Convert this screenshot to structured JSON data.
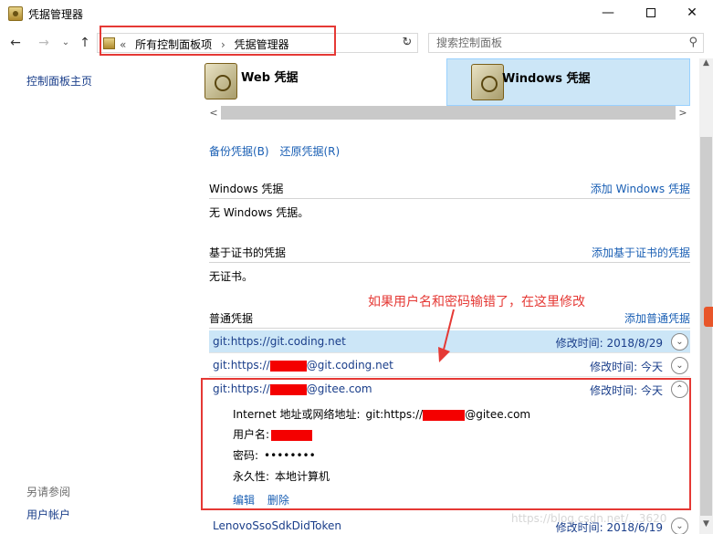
{
  "window": {
    "title": "凭据管理器",
    "min_glyph": "—",
    "close_glyph": "✕"
  },
  "nav": {
    "back_glyph": "←",
    "forward_glyph": "→",
    "history_glyph": "⌄",
    "up_glyph": "↑",
    "breadcrumb_prefix": "«",
    "breadcrumbs": [
      "所有控制面板项",
      "凭据管理器"
    ],
    "crumb_sep": "›",
    "dropdown_glyph": "⌄",
    "refresh_glyph": "↻",
    "search_placeholder": "搜索控制面板",
    "search_glyph": "⚲"
  },
  "sidebar": {
    "home": "控制面板主页",
    "see_also": "另请参阅",
    "user_accounts": "用户帐户"
  },
  "tabs": {
    "web": "Web 凭据",
    "windows": "Windows 凭据"
  },
  "hscroll": {
    "left_glyph": "<",
    "right_glyph": ">"
  },
  "actions": {
    "backup": "备份凭据(B)",
    "restore": "还原凭据(R)"
  },
  "sections": {
    "windows": {
      "name": "Windows 凭据",
      "add": "添加 Windows 凭据",
      "empty": "无 Windows 凭据。"
    },
    "cert": {
      "name": "基于证书的凭据",
      "add": "添加基于证书的凭据",
      "empty": "无证书。"
    },
    "generic": {
      "name": "普通凭据",
      "add": "添加普通凭据"
    }
  },
  "credentials": [
    {
      "name": "git:https://git.coding.net",
      "modified": "修改时间:  2018/8/29",
      "expanded": false,
      "selected": true
    },
    {
      "name_prefix": "git:https://",
      "name_suffix": "@git.coding.net",
      "modified": "修改时间:  今天",
      "expanded": false
    },
    {
      "name_prefix": "git:https://",
      "name_suffix": "@gitee.com",
      "modified": "修改时间:  今天",
      "expanded": true
    },
    {
      "name": "LenovoSsoSdkDidToken",
      "modified": "修改时间:  2018/6/19",
      "expanded": false
    }
  ],
  "detail": {
    "address_label": "Internet 地址或网络地址:",
    "address_prefix": "git:https://",
    "address_suffix": "@gitee.com",
    "username_label": "用户名:",
    "password_label": "密码:",
    "password_value": "••••••••",
    "persistence_label": "永久性:",
    "persistence_value": "本地计算机",
    "edit": "编辑",
    "delete": "删除"
  },
  "chevrons": {
    "down": "⌄",
    "up": "⌃"
  },
  "scroll": {
    "up": "▲",
    "down": "▼"
  },
  "annotation": "如果用户名和密码输错了，在这里修改",
  "watermark": "https://blog.csdn.net/...3620",
  "colors": {
    "accent": "#1a5fb4",
    "selection": "#cce6f7",
    "annotation": "#e53935",
    "redaction": "#f40000"
  }
}
